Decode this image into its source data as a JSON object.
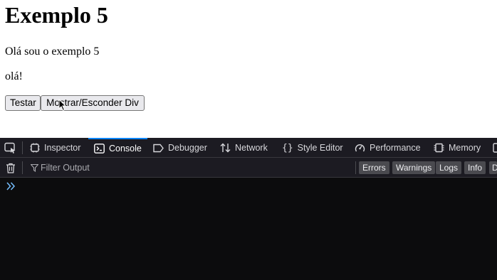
{
  "page": {
    "heading": "Exemplo 5",
    "paragraph1": "Olá sou o exemplo 5",
    "paragraph2": "olá!",
    "button_test": "Testar",
    "button_toggle": "Mostrar/Esconder Div"
  },
  "devtools": {
    "tabs": [
      {
        "label": "Inspector",
        "icon": "inspector-icon"
      },
      {
        "label": "Console",
        "icon": "console-icon",
        "active": true
      },
      {
        "label": "Debugger",
        "icon": "debugger-icon"
      },
      {
        "label": "Network",
        "icon": "network-icon"
      },
      {
        "label": "Style Editor",
        "icon": "style-editor-icon"
      },
      {
        "label": "Performance",
        "icon": "performance-icon"
      },
      {
        "label": "Memory",
        "icon": "memory-icon"
      }
    ],
    "filter_placeholder": "Filter Output",
    "levels": [
      "Errors",
      "Warnings",
      "Logs",
      "Info",
      "D"
    ],
    "colors": {
      "accent": "#0a84ff",
      "toolbar_bg": "#1c1b22",
      "console_bg": "#0c0c0d",
      "prompt": "#75bfff"
    }
  }
}
